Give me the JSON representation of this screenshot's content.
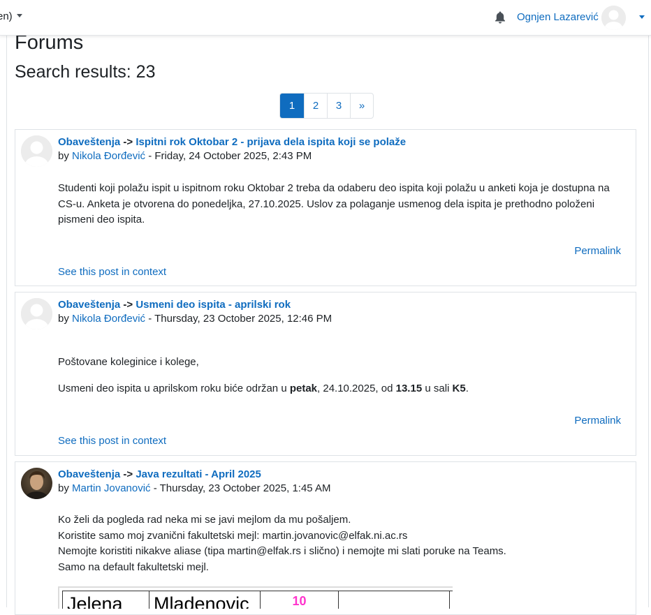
{
  "navbar": {
    "language_fragment": "en)",
    "user_name": "Ognjen Lazarević"
  },
  "page": {
    "title": "Forums",
    "search_results": "Search results: 23"
  },
  "pagination": {
    "pages": [
      "1",
      "2",
      "3",
      "»"
    ],
    "active_page": "1"
  },
  "posts": [
    {
      "forum": "Obaveštenja",
      "separator": "->",
      "subject": "Ispitni rok Oktobar 2 - prijava dela ispita koji se polaže",
      "by": "by",
      "author": "Nikola Đorđević",
      "date": " - Friday, 24 October 2025, 2:43 PM",
      "body": "Studenti koji polažu ispit u ispitnom roku Oktobar 2 treba da odaberu deo ispita koji polažu u anketi koja je dostupna na CS-u. Anketa je otvorena do ponedeljka, 27.10.2025. Uslov za polaganje usmenog dela ispita je prethodno položeni pismeni deo ispita.",
      "permalink": "Permalink",
      "context": "See this post in context"
    },
    {
      "forum": "Obaveštenja",
      "separator": "->",
      "subject": "Usmeni deo ispita - aprilski rok",
      "by": "by",
      "author": "Nikola Đorđević",
      "date": " - Thursday, 23 October 2025, 12:46 PM",
      "greeting": "Poštovane koleginice i kolege,",
      "body_pre": "Usmeni deo ispita u aprilskom roku biće održan u ",
      "body_b1": "petak",
      "body_mid1": ", 24.10.2025, od ",
      "body_b2": "13.15",
      "body_mid2": " u sali ",
      "body_b3": "K5",
      "body_end": ".",
      "permalink": "Permalink",
      "context": "See this post in context"
    },
    {
      "forum": "Obaveštenja",
      "separator": "->",
      "subject": "Java rezultati - April 2025",
      "by": "by",
      "author": "Martin Jovanović",
      "date": " - Thursday, 23 October 2025, 1:45 AM",
      "lines": [
        "Ko želi da pogleda rad neka mi se javi mejlom da mu pošaljem.",
        "Koristite samo moj zvanični fakultetski mejl: martin.jovanovic@elfak.ni.ac.rs",
        "Nemojte koristiti nikakve aliase (tipa martin@elfak.rs i slično) i nemojte mi slati poruke na Teams.",
        "Samo na default fakultetski mejl."
      ],
      "table_cells": [
        "Jelena",
        "Mladenovic",
        "10",
        ""
      ]
    }
  ]
}
